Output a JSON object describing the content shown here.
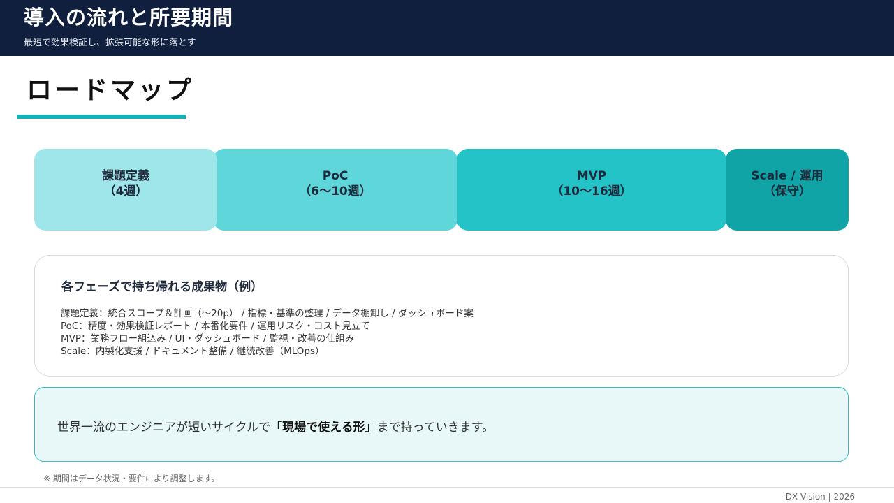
{
  "header": {
    "title": "導入の流れと所要期間",
    "subtitle": "最短で効果検証し、拡張可能な形に落とす"
  },
  "section": {
    "title": "ロードマップ"
  },
  "roadmap": {
    "phases": [
      {
        "name": "課題定義",
        "duration": "（4週）"
      },
      {
        "name": "PoC",
        "duration": "（6〜10週）"
      },
      {
        "name": "MVP",
        "duration": "（10〜16週）"
      },
      {
        "name": "Scale / 運用",
        "duration": "（保守）"
      }
    ]
  },
  "deliverables": {
    "title": "各フェーズで持ち帰れる成果物（例）",
    "items": [
      "課題定義：統合スコープ＆計画（〜20p） /  指標・基準の整理 / データ棚卸し / ダッシュボード案",
      "PoC：精度・効果検証レポート / 本番化要件 / 運用リスク・コスト見立て",
      "MVP：業務フロー組込み / UI・ダッシュボード / 監視・改善の仕組み",
      "Scale：内製化支援 / ドキュメント整備 / 継続改善（MLOps）"
    ]
  },
  "message": {
    "before": "世界一流のエンジニアが短いサイクルで",
    "emphasis": "「現場で使える形」",
    "after": "まで持っていきます。"
  },
  "footnote": "※ 期間はデータ状況・要件により調整します。",
  "footer": {
    "brand": "DX Vision | 2026"
  },
  "colors": {
    "header_bg": "#0f1f3d",
    "accent": "#14b1b5",
    "phase_1": "#9fe6ea",
    "phase_2": "#5fd6da",
    "phase_3": "#24c3c8",
    "phase_4": "#10a4a7",
    "message_bg": "#e8f8f8"
  }
}
